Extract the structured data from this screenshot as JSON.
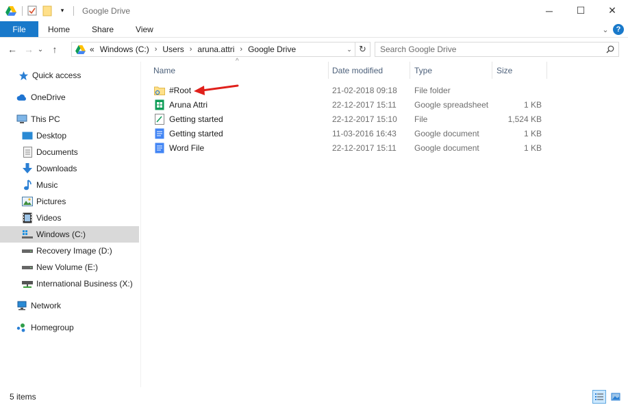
{
  "window": {
    "title": "Google Drive",
    "controls": {
      "minimize": "─",
      "maximize": "☐",
      "close": "✕"
    }
  },
  "ribbon": {
    "tabs": [
      "File",
      "Home",
      "Share",
      "View"
    ],
    "collapse": "⌄",
    "help": "?"
  },
  "address": {
    "back": "←",
    "forward": "→",
    "recent": "⌄",
    "up": "↑",
    "overflow": "«",
    "breadcrumbs": [
      "Windows (C:)",
      "Users",
      "aruna.attri",
      "Google Drive"
    ],
    "crumb_sep": "›",
    "dropdown": "⌄",
    "refresh": "↻"
  },
  "search": {
    "placeholder": "Search Google Drive"
  },
  "nav": {
    "items": [
      {
        "label": "Quick access",
        "icon": "star-icon"
      },
      {
        "label": "OneDrive",
        "icon": "cloud-icon"
      },
      {
        "label": "This PC",
        "icon": "computer-icon"
      },
      {
        "label": "Desktop",
        "icon": "desktop-icon"
      },
      {
        "label": "Documents",
        "icon": "documents-icon"
      },
      {
        "label": "Downloads",
        "icon": "download-icon"
      },
      {
        "label": "Music",
        "icon": "music-icon"
      },
      {
        "label": "Pictures",
        "icon": "pictures-icon"
      },
      {
        "label": "Videos",
        "icon": "videos-icon"
      },
      {
        "label": "Windows (C:)",
        "icon": "drive-c-icon",
        "selected": true
      },
      {
        "label": "Recovery Image (D:)",
        "icon": "drive-icon"
      },
      {
        "label": "New Volume (E:)",
        "icon": "drive-icon"
      },
      {
        "label": "International Business (X:)",
        "icon": "network-drive-icon"
      },
      {
        "label": "Network",
        "icon": "network-icon"
      },
      {
        "label": "Homegroup",
        "icon": "homegroup-icon"
      }
    ]
  },
  "columns": {
    "name": "Name",
    "date": "Date modified",
    "type": "Type",
    "size": "Size"
  },
  "files": [
    {
      "name": "#Root",
      "date": "21-02-2018 09:18",
      "type": "File folder",
      "size": "",
      "icon": "sync-folder-icon"
    },
    {
      "name": "Aruna Attri",
      "date": "22-12-2017 15:11",
      "type": "Google spreadsheet",
      "size": "1 KB",
      "icon": "google-sheets-icon"
    },
    {
      "name": "Getting started",
      "date": "22-12-2017 15:10",
      "type": "File",
      "size": "1,524 KB",
      "icon": "file-icon"
    },
    {
      "name": "Getting started",
      "date": "11-03-2016 16:43",
      "type": "Google document",
      "size": "1 KB",
      "icon": "google-docs-icon"
    },
    {
      "name": "Word File",
      "date": "22-12-2017 15:11",
      "type": "Google document",
      "size": "1 KB",
      "icon": "google-docs-icon"
    }
  ],
  "status": {
    "items": "5 items"
  },
  "colors": {
    "accent": "#1979ca",
    "selected": "#d9d9d9",
    "header": "#4c607a",
    "arrow": "#e0201b"
  }
}
